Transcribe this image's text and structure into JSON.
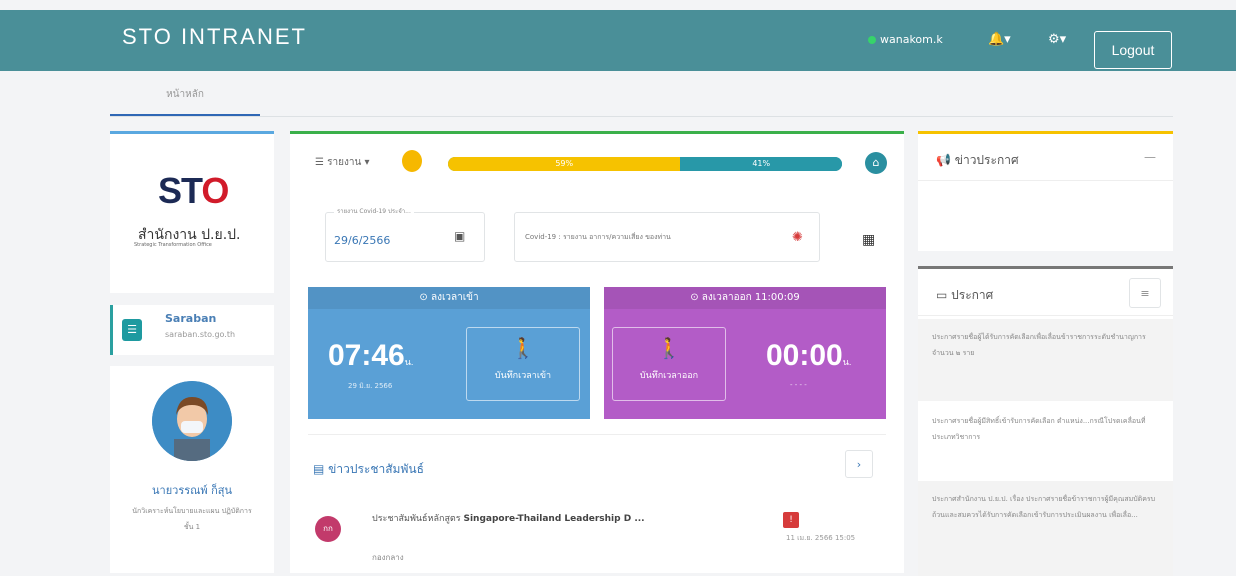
{
  "header": {
    "brand": "STO INTRANET",
    "username": "wanakom.k",
    "logout_label": "Logout",
    "bell_icon": "bell-icon",
    "gear_icon": "gear-icon",
    "online_color": "#36d36a",
    "bar_color": "#4a8f98"
  },
  "nav": {
    "active_tab": "หน้าหลัก"
  },
  "sidebar": {
    "logo_text": "ST",
    "logo_red": "O",
    "org_name_th": "สำนักงาน ป.ย.ป.",
    "org_name_en": "Strategic Transformation Office",
    "saraban_title": "Saraban",
    "saraban_url": "saraban.sto.go.th",
    "person_name": "นายวรรณพ์ ก็สุน",
    "person_role": "นักวิเคราะห์นโยบายและแผน ปฏิบัติการ",
    "person_role2": "ชั้น 1"
  },
  "main": {
    "menu_label": "☰ รายงาน ▾",
    "progress": {
      "seg1_pct": 59,
      "seg1_label": "59%",
      "seg2_pct": 41,
      "seg2_label": "41%"
    },
    "date_label": "รายงาน Covid-19 ประจำ...",
    "date_value": "29/6/2566",
    "covid_text": "Covid-19 : รายงาน อาการ/ความเสี่ยง ของท่าน",
    "checkin": {
      "header": "⊙ ลงเวลาเข้า",
      "time": "07:46",
      "unit": "น.",
      "date": "29 มิ.ย. 2566",
      "button": "บันทึกเวลาเข้า"
    },
    "checkout": {
      "header": "⊙ ลงเวลาออก 11:00:09",
      "time": "00:00",
      "unit": "น.",
      "date": "- - - -",
      "button": "บันทึกเวลาออก"
    },
    "news_title": "▤ ข่าวประชาสัมพันธ์",
    "news_next": "›",
    "news_item": {
      "avatar": "กก",
      "text_prefix": "ประชาสัมพันธ์หลักสูตร ",
      "text_bold": "Singapore-Thailand Leadership D ...",
      "badge": "!",
      "date": "11 เม.ย. 2566 15:05",
      "sub": "กองกลาง"
    }
  },
  "right": {
    "news_title": "📢 ข่าวประกาศ",
    "news_collapse": "—",
    "ann_title": "▭ ประกาศ",
    "ann_menu": "≡",
    "announcements": [
      "ประกาศรายชื่อผู้ได้รับการคัดเลือกเพื่อเลื่อนข้าราชการระดับชำนาญการ จำนวน ๒ ราย",
      "ประกาศรายชื่อผู้มีสิทธิ์เข้ารับการคัดเลือก ตำแหน่ง...กรณีโปรดเคลื่อนที่ประเภทวิชาการ",
      "ประกาศสำนักงาน ป.ย.ป. เรื่อง ประกาศรายชื่อข้าราชการผู้มีคุณสมบัติครบถ้วนและสมควรได้รับการคัดเลือกเข้ารับการประเมินผลงาน เพื่อเลื่อ..."
    ]
  }
}
